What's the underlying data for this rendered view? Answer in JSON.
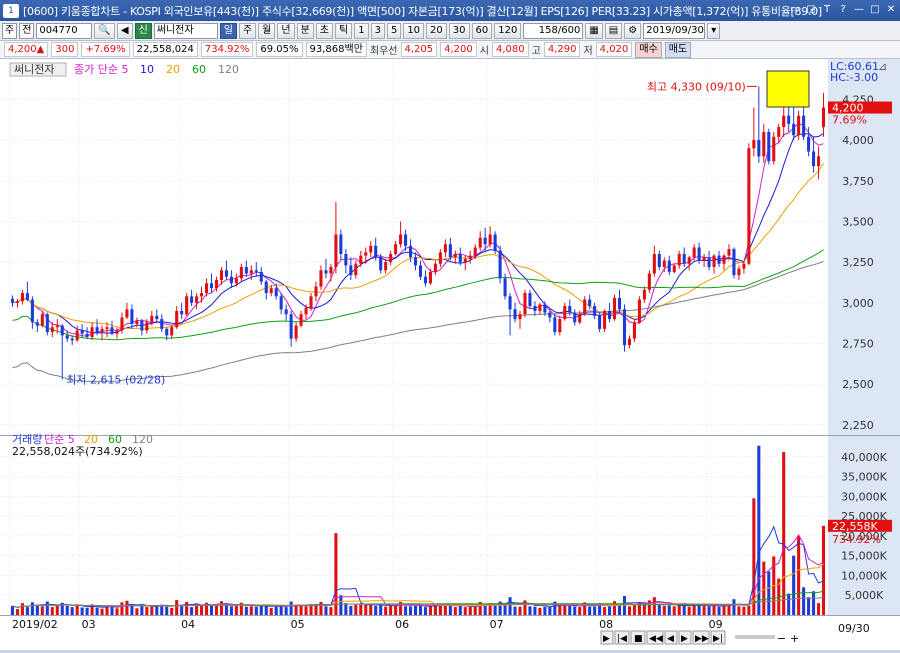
{
  "window": {
    "icon": "1",
    "title": "[0600] 키움종합차트 - KOSPI 외국인보유[443(천)] 주식수[32,669(천)] 액면[500] 자본금[173(억)] 결산[12월] EPS[126] PER[33.23] 시가총액[1,372(억)] 유통비율[89.0]",
    "controls": [
      "▭",
      "◲",
      "T",
      "?",
      "—",
      "□",
      "✕"
    ]
  },
  "toolbar": {
    "market": "주",
    "period_type": "전",
    "code": "004770",
    "stock_badge": "신",
    "stock_name": "써니전자",
    "period_buttons": [
      "일",
      "주",
      "월",
      "년",
      "분",
      "초",
      "틱"
    ],
    "active_period": "일",
    "interval_buttons": [
      "1",
      "3",
      "5",
      "10",
      "20",
      "30",
      "60",
      "120"
    ],
    "count": "158/600",
    "date": "2019/09/30"
  },
  "quote": {
    "price": "4,200",
    "arrow": "▲",
    "change": "300",
    "change_pct": "+7.69%",
    "volume": "22,558,024",
    "volume_ratio": "734.92%",
    "turnover": "69.05%",
    "amount": "93,868백만",
    "prior_label": "최우선",
    "prior_value": "4,205",
    "close_value": "4,200",
    "open_label": "시",
    "open_value": "4,080",
    "high_label": "고",
    "high_value": "4,290",
    "low_label": "저",
    "low_value": "4,020",
    "buy_label": "매수",
    "sell_label": "매도"
  },
  "price_pane": {
    "stock_label": "써니전자",
    "legend": [
      {
        "label": "종가 단순 5",
        "color": "#d020d0"
      },
      {
        "label": "10",
        "color": "#1818d8"
      },
      {
        "label": "20",
        "color": "#f0a000"
      },
      {
        "label": "60",
        "color": "#10a010"
      },
      {
        "label": "120",
        "color": "#808080"
      }
    ],
    "high_annotation": "최고 4,330 (09/10)",
    "low_annotation": "최저 2,615 (02/28)",
    "lc_label": "LC:60.61",
    "hc_label": "HC:-3.00",
    "cur_label": "4,200",
    "pct_label": "7.69%",
    "cur_value": 4200,
    "yticks": [
      4250,
      4000,
      3750,
      3500,
      3250,
      3000,
      2750,
      2500,
      2250
    ],
    "ytick_labels": [
      "4,250",
      "4,000",
      "3,750",
      "3,500",
      "3,250",
      "3,000",
      "2,750",
      "2,500",
      "2,250"
    ],
    "ylim": [
      2200,
      4400
    ],
    "colors": {
      "up": "#e01010",
      "down": "#1c3cd8"
    }
  },
  "volume_pane": {
    "legend": [
      {
        "label": "거래량",
        "color": "#1c3cd8"
      },
      {
        "label": "단순 5",
        "color": "#d020d0"
      },
      {
        "label": "20",
        "color": "#f0a000"
      },
      {
        "label": "60",
        "color": "#10a010"
      },
      {
        "label": "120",
        "color": "#808080"
      }
    ],
    "summary": "22,558,024주(734.92%)",
    "yticks": [
      40000,
      35000,
      30000,
      25000,
      20000,
      15000,
      10000,
      5000
    ],
    "ytick_labels": [
      "40,000K",
      "35,000K",
      "30,000K",
      "25,000K",
      "20,000K",
      "15,000K",
      "10,000K",
      "5,000K"
    ],
    "ylim": [
      0,
      44000
    ],
    "cur_label": "22,558K",
    "pct_label": "734.92%",
    "cur_value": 22558
  },
  "xaxis": {
    "labels": [
      {
        "label": "2019/02",
        "idx": 0
      },
      {
        "label": "03",
        "idx": 14
      },
      {
        "label": "04",
        "idx": 34
      },
      {
        "label": "05",
        "idx": 56
      },
      {
        "label": "06",
        "idx": 77
      },
      {
        "label": "07",
        "idx": 96
      },
      {
        "label": "08",
        "idx": 118
      },
      {
        "label": "09",
        "idx": 140
      }
    ],
    "end_label": "09/30"
  },
  "chart_data": {
    "type": "candlestick",
    "ohlc_columns": [
      "open",
      "high",
      "low",
      "close"
    ],
    "ohlc": [
      [
        3025,
        3045,
        2975,
        3000
      ],
      [
        3000,
        3025,
        2970,
        3010
      ],
      [
        3010,
        3080,
        2990,
        3060
      ],
      [
        3060,
        3130,
        3010,
        3020
      ],
      [
        3020,
        3040,
        2840,
        2880
      ],
      [
        2880,
        2900,
        2820,
        2860
      ],
      [
        2860,
        2950,
        2850,
        2930
      ],
      [
        2930,
        2940,
        2800,
        2820
      ],
      [
        2820,
        2880,
        2790,
        2850
      ],
      [
        2850,
        2900,
        2810,
        2860
      ],
      [
        2860,
        2870,
        2615,
        2800
      ],
      [
        2800,
        2830,
        2760,
        2780
      ],
      [
        2780,
        2800,
        2740,
        2770
      ],
      [
        2770,
        2860,
        2760,
        2830
      ],
      [
        2830,
        2870,
        2790,
        2810
      ],
      [
        2810,
        2850,
        2780,
        2790
      ],
      [
        2790,
        2880,
        2770,
        2850
      ],
      [
        2850,
        2900,
        2800,
        2820
      ],
      [
        2820,
        2860,
        2770,
        2840
      ],
      [
        2840,
        2880,
        2790,
        2850
      ],
      [
        2850,
        2890,
        2800,
        2810
      ],
      [
        2810,
        2850,
        2780,
        2830
      ],
      [
        2830,
        2940,
        2810,
        2910
      ],
      [
        2910,
        3000,
        2900,
        2960
      ],
      [
        2960,
        2990,
        2840,
        2870
      ],
      [
        2870,
        2910,
        2850,
        2890
      ],
      [
        2890,
        2900,
        2800,
        2830
      ],
      [
        2830,
        2900,
        2810,
        2880
      ],
      [
        2880,
        2950,
        2860,
        2920
      ],
      [
        2920,
        2960,
        2880,
        2900
      ],
      [
        2900,
        2930,
        2820,
        2840
      ],
      [
        2840,
        2850,
        2770,
        2800
      ],
      [
        2800,
        2860,
        2780,
        2850
      ],
      [
        2850,
        2980,
        2840,
        2950
      ],
      [
        2950,
        3000,
        2900,
        2930
      ],
      [
        2930,
        3060,
        2920,
        3040
      ],
      [
        3040,
        3080,
        2980,
        3000
      ],
      [
        3000,
        3060,
        2960,
        3040
      ],
      [
        3040,
        3100,
        3000,
        3060
      ],
      [
        3060,
        3150,
        3040,
        3120
      ],
      [
        3120,
        3180,
        3060,
        3090
      ],
      [
        3090,
        3160,
        3070,
        3140
      ],
      [
        3140,
        3220,
        3110,
        3200
      ],
      [
        3200,
        3260,
        3140,
        3160
      ],
      [
        3160,
        3200,
        3090,
        3120
      ],
      [
        3120,
        3180,
        3100,
        3150
      ],
      [
        3150,
        3240,
        3130,
        3220
      ],
      [
        3220,
        3260,
        3160,
        3180
      ],
      [
        3180,
        3230,
        3140,
        3200
      ],
      [
        3200,
        3250,
        3160,
        3190
      ],
      [
        3190,
        3220,
        3110,
        3130
      ],
      [
        3130,
        3140,
        3020,
        3060
      ],
      [
        3060,
        3110,
        3040,
        3090
      ],
      [
        3090,
        3120,
        3020,
        3040
      ],
      [
        3040,
        3060,
        2930,
        2960
      ],
      [
        2960,
        2990,
        2890,
        2930
      ],
      [
        2930,
        2950,
        2730,
        2780
      ],
      [
        2780,
        2880,
        2760,
        2860
      ],
      [
        2860,
        2950,
        2850,
        2930
      ],
      [
        2930,
        2990,
        2900,
        2970
      ],
      [
        2970,
        3060,
        2950,
        3040
      ],
      [
        3040,
        3130,
        3010,
        3100
      ],
      [
        3100,
        3230,
        3080,
        3200
      ],
      [
        3200,
        3270,
        3150,
        3180
      ],
      [
        3180,
        3240,
        3130,
        3220
      ],
      [
        3220,
        3620,
        3180,
        3420
      ],
      [
        3420,
        3450,
        3260,
        3300
      ],
      [
        3300,
        3330,
        3180,
        3230
      ],
      [
        3230,
        3280,
        3140,
        3170
      ],
      [
        3170,
        3260,
        3150,
        3240
      ],
      [
        3240,
        3320,
        3220,
        3290
      ],
      [
        3290,
        3340,
        3240,
        3310
      ],
      [
        3310,
        3380,
        3280,
        3350
      ],
      [
        3350,
        3400,
        3260,
        3280
      ],
      [
        3280,
        3300,
        3180,
        3200
      ],
      [
        3200,
        3270,
        3180,
        3250
      ],
      [
        3250,
        3320,
        3230,
        3300
      ],
      [
        3300,
        3380,
        3290,
        3360
      ],
      [
        3360,
        3500,
        3340,
        3420
      ],
      [
        3420,
        3450,
        3320,
        3350
      ],
      [
        3350,
        3390,
        3250,
        3280
      ],
      [
        3280,
        3310,
        3200,
        3230
      ],
      [
        3230,
        3260,
        3140,
        3160
      ],
      [
        3160,
        3200,
        3100,
        3120
      ],
      [
        3120,
        3210,
        3110,
        3190
      ],
      [
        3190,
        3260,
        3170,
        3240
      ],
      [
        3240,
        3330,
        3220,
        3310
      ],
      [
        3310,
        3390,
        3280,
        3360
      ],
      [
        3360,
        3400,
        3260,
        3280
      ],
      [
        3280,
        3320,
        3240,
        3300
      ],
      [
        3300,
        3340,
        3230,
        3250
      ],
      [
        3250,
        3290,
        3200,
        3270
      ],
      [
        3270,
        3320,
        3240,
        3290
      ],
      [
        3290,
        3360,
        3270,
        3340
      ],
      [
        3340,
        3440,
        3320,
        3400
      ],
      [
        3400,
        3460,
        3320,
        3360
      ],
      [
        3360,
        3470,
        3340,
        3420
      ],
      [
        3420,
        3440,
        3300,
        3320
      ],
      [
        3320,
        3350,
        3120,
        3150
      ],
      [
        3150,
        3180,
        3020,
        3040
      ],
      [
        3040,
        3060,
        2800,
        2960
      ],
      [
        2960,
        3000,
        2880,
        2900
      ],
      [
        2900,
        2950,
        2840,
        2930
      ],
      [
        2930,
        3080,
        2910,
        3060
      ],
      [
        3060,
        3080,
        2960,
        2980
      ],
      [
        2980,
        3010,
        2920,
        2950
      ],
      [
        2950,
        3000,
        2930,
        2990
      ],
      [
        2990,
        3010,
        2920,
        2940
      ],
      [
        2940,
        2960,
        2880,
        2910
      ],
      [
        2910,
        2930,
        2800,
        2820
      ],
      [
        2820,
        2920,
        2800,
        2900
      ],
      [
        2900,
        3000,
        2890,
        2980
      ],
      [
        2980,
        3020,
        2920,
        2940
      ],
      [
        2940,
        2960,
        2860,
        2880
      ],
      [
        2880,
        2950,
        2870,
        2930
      ],
      [
        2930,
        3040,
        2920,
        3020
      ],
      [
        3020,
        3050,
        2960,
        2980
      ],
      [
        2980,
        3000,
        2900,
        2920
      ],
      [
        2920,
        2940,
        2820,
        2840
      ],
      [
        2840,
        2960,
        2820,
        2950
      ],
      [
        2950,
        3000,
        2880,
        2900
      ],
      [
        2900,
        3050,
        2890,
        3030
      ],
      [
        3030,
        3080,
        2940,
        2960
      ],
      [
        2960,
        2990,
        2700,
        2740
      ],
      [
        2740,
        2800,
        2720,
        2780
      ],
      [
        2780,
        2900,
        2760,
        2880
      ],
      [
        2880,
        3040,
        2870,
        3020
      ],
      [
        3020,
        3100,
        3000,
        3080
      ],
      [
        3080,
        3200,
        3060,
        3180
      ],
      [
        3180,
        3350,
        3160,
        3300
      ],
      [
        3300,
        3320,
        3200,
        3220
      ],
      [
        3220,
        3280,
        3190,
        3260
      ],
      [
        3260,
        3290,
        3170,
        3190
      ],
      [
        3190,
        3240,
        3180,
        3230
      ],
      [
        3230,
        3320,
        3210,
        3300
      ],
      [
        3300,
        3340,
        3220,
        3240
      ],
      [
        3240,
        3290,
        3200,
        3280
      ],
      [
        3280,
        3360,
        3260,
        3340
      ],
      [
        3340,
        3370,
        3240,
        3260
      ],
      [
        3260,
        3300,
        3220,
        3280
      ],
      [
        3280,
        3320,
        3200,
        3220
      ],
      [
        3220,
        3300,
        3180,
        3290
      ],
      [
        3290,
        3320,
        3220,
        3240
      ],
      [
        3240,
        3300,
        3200,
        3290
      ],
      [
        3290,
        3360,
        3260,
        3330
      ],
      [
        3330,
        3340,
        3150,
        3170
      ],
      [
        3170,
        3230,
        3140,
        3210
      ],
      [
        3210,
        3260,
        3180,
        3240
      ],
      [
        3240,
        3980,
        3230,
        3950
      ],
      [
        3950,
        4200,
        3900,
        4000
      ],
      [
        4000,
        4330,
        3860,
        3900
      ],
      [
        3900,
        4100,
        3860,
        4050
      ],
      [
        4050,
        4070,
        3850,
        3870
      ],
      [
        3870,
        4050,
        3850,
        4020
      ],
      [
        4020,
        4100,
        3980,
        4080
      ],
      [
        4080,
        4200,
        4020,
        4150
      ],
      [
        4150,
        4250,
        4050,
        4100
      ],
      [
        4100,
        4200,
        4000,
        4030
      ],
      [
        4030,
        4180,
        4000,
        4150
      ],
      [
        4150,
        4210,
        4000,
        4020
      ],
      [
        4020,
        4080,
        3900,
        3930
      ],
      [
        3930,
        4020,
        3800,
        3840
      ],
      [
        3840,
        3960,
        3760,
        3900
      ],
      [
        4080,
        4290,
        4020,
        4200
      ]
    ],
    "volume": [
      2300,
      1500,
      3000,
      2000,
      3200,
      2600,
      2200,
      3400,
      2000,
      2600,
      3100,
      2300,
      2000,
      2500,
      1900,
      1800,
      2700,
      1900,
      1600,
      2100,
      2400,
      1700,
      3200,
      3600,
      2500,
      1700,
      2300,
      2000,
      2500,
      2100,
      2600,
      2100,
      1800,
      3800,
      2200,
      3300,
      2000,
      2800,
      2300,
      3100,
      2600,
      2800,
      3500,
      2400,
      2200,
      2300,
      3100,
      2100,
      2200,
      2100,
      2300,
      2600,
      1800,
      2100,
      2400,
      2000,
      3400,
      2400,
      2500,
      2200,
      2600,
      2800,
      3300,
      2200,
      2000,
      20700,
      5000,
      3000,
      2300,
      2600,
      2600,
      2500,
      2800,
      2300,
      2400,
      2100,
      2400,
      2500,
      3300,
      2200,
      2200,
      2300,
      2500,
      2000,
      2300,
      2300,
      2700,
      2900,
      2400,
      2000,
      2300,
      2000,
      2100,
      2200,
      3300,
      2600,
      3000,
      2500,
      3400,
      2900,
      4500,
      2100,
      2100,
      3700,
      2200,
      2100,
      1800,
      2100,
      2100,
      3400,
      2300,
      2600,
      2300,
      2100,
      2000,
      3200,
      2100,
      2100,
      3000,
      2000,
      2100,
      3500,
      2700,
      4800,
      2200,
      2400,
      3300,
      2900,
      3700,
      4500,
      2500,
      2300,
      2400,
      2200,
      2500,
      2700,
      2100,
      2500,
      2600,
      2300,
      2200,
      2400,
      2100,
      2400,
      2700,
      4000,
      2200,
      2100,
      2300,
      29500,
      42800,
      13500,
      11000,
      14800,
      9200,
      41200,
      5400,
      15000,
      20000,
      7000,
      4500,
      6000,
      3000,
      22558
    ],
    "ma_periods": [
      5,
      10,
      20,
      60,
      120
    ]
  }
}
